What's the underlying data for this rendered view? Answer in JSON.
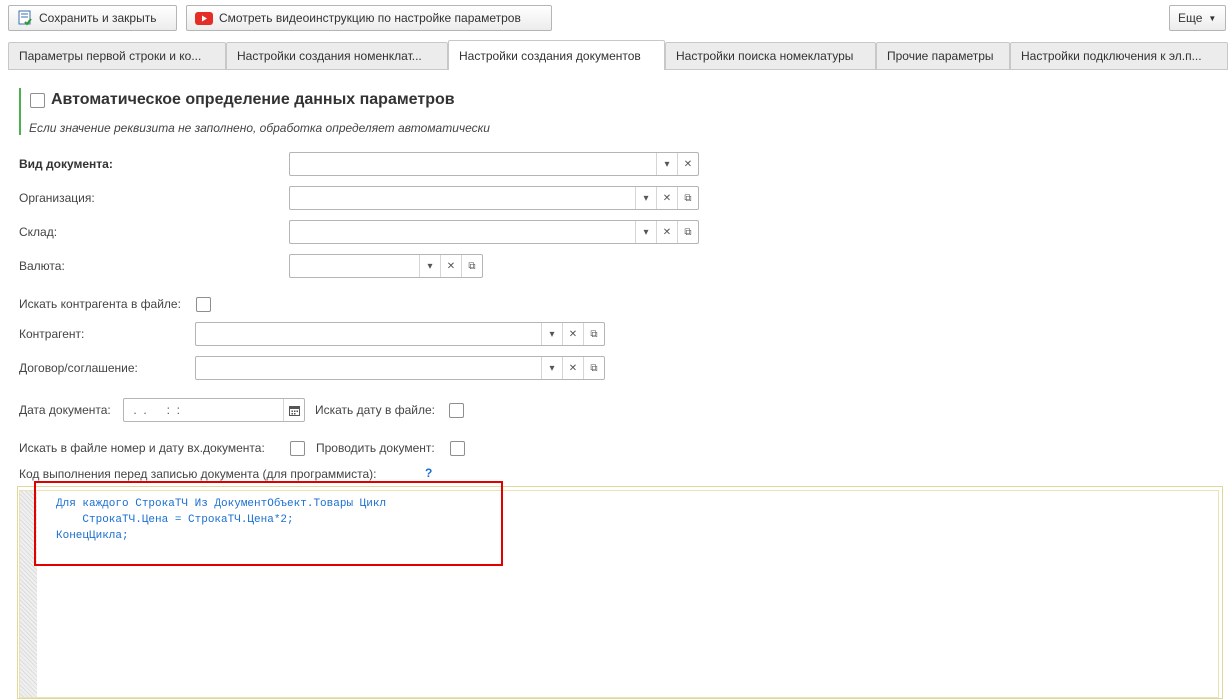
{
  "toolbar": {
    "save_close": "Сохранить и закрыть",
    "video": "Смотреть видеоинструкцию по настройке параметров",
    "more": "Еще"
  },
  "tabs": [
    {
      "label": "Параметры первой строки и ко..."
    },
    {
      "label": "Настройки создания номенклат..."
    },
    {
      "label": "Настройки создания документов"
    },
    {
      "label": "Настройки поиска номеклатуры"
    },
    {
      "label": "Прочие параметры"
    },
    {
      "label": "Настройки подключения к эл.п..."
    }
  ],
  "auto": {
    "title": "Автоматическое определение данных параметров",
    "hint": "Если значение реквизита не заполнено, обработка определяет автоматически"
  },
  "form": {
    "doc_type": "Вид документа:",
    "org": "Организация:",
    "warehouse": "Склад:",
    "currency": "Валюта:",
    "search_contractor": "Искать контрагента в файле:",
    "contractor": "Контрагент:",
    "contract": "Договор/соглашение:",
    "doc_date": "Дата документа:",
    "doc_date_value": " .  .      :  :",
    "search_date": "Искать дату в файле:",
    "search_number": "Искать в файле номер и дату вх.документа:",
    "post_doc": "Проводить документ:",
    "code_label": "Код выполнения перед записью документа (для программиста):",
    "help": "?"
  },
  "code_lines": [
    "Для каждого СтрокаТЧ Из ДокументОбъект.Товары Цикл",
    "    СтрокаТЧ.Цена = СтрокаТЧ.Цена*2;",
    "КонецЦикла;"
  ],
  "colors": {
    "accent_green": "#4caf50",
    "code_blue": "#1a6fd1",
    "highlight_red": "#e00000"
  }
}
